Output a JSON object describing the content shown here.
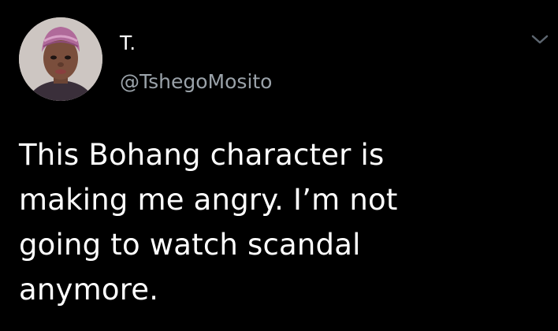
{
  "theme": {
    "background": "#000000",
    "text": "#ffffff",
    "secondary_text": "#9aa2a9"
  },
  "author": {
    "display_name": "T.",
    "handle": "@TshegoMosito",
    "avatar_icon": "user-avatar-photo"
  },
  "tweet": {
    "lines": [
      "This Bohang character is",
      "making me angry. I’m not",
      "going to watch scandal",
      "anymore."
    ]
  },
  "menu": {
    "icon": "chevron-down-icon"
  }
}
